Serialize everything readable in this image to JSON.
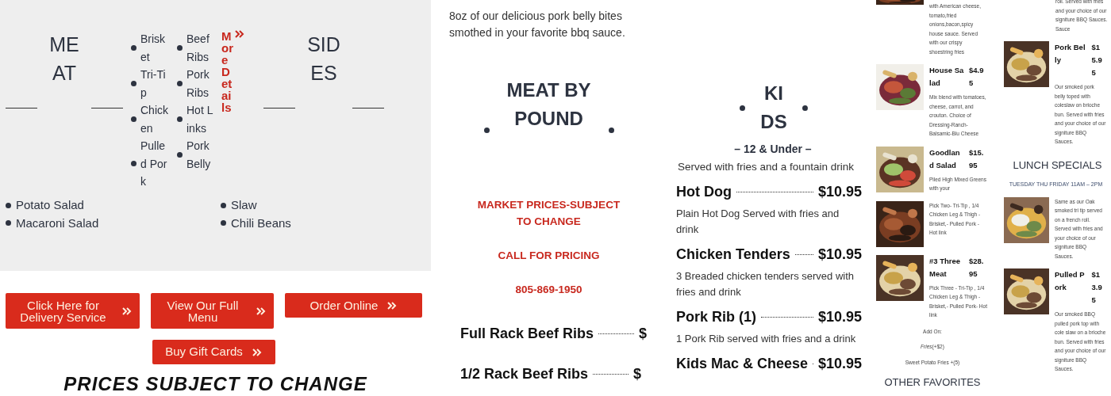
{
  "left": {
    "meat_heading": "MEAT",
    "meats_1": [
      "Brisket",
      "Tri-Tip",
      "Chicken",
      "Pulled Pork"
    ],
    "meats_2": [
      "Beef Ribs",
      "Pork Ribs",
      "Hot Links",
      "Pork Belly"
    ],
    "more_link": "More Details",
    "sides_heading": "SIDES",
    "sides_1": [
      "Potato Salad",
      "Macaroni Salad"
    ],
    "sides_2": [
      "Slaw",
      "Chili Beans"
    ],
    "buttons": [
      "Click Here for Delivery Service",
      "View Our Full Menu",
      "Order Online",
      "Buy Gift Cards"
    ],
    "banner": "PRICES SUBJECT TO CHANGE"
  },
  "pork_belly_bites": {
    "description": "8oz of our delicious pork belly bites smothed in your favorite bbq sauce."
  },
  "meat_by_pound": {
    "heading": "MEAT BY POUND",
    "notices": [
      "MARKET PRICES-SUBJECT TO CHANGE",
      "CALL FOR PRICING",
      "805-869-1950"
    ],
    "items": [
      {
        "name": "Full Rack Beef Ribs",
        "price": "$"
      },
      {
        "name": "1/2 Rack Beef Ribs",
        "price": "$"
      }
    ]
  },
  "kids": {
    "heading": "KIDS",
    "subheading": "– 12 & Under –",
    "note": "Served with fries and a fountain drink",
    "items": [
      {
        "name": "Hot Dog",
        "price": "$10.95",
        "description": "Plain Hot Dog Served with fries and drink"
      },
      {
        "name": "Chicken Tenders",
        "price": "$10.95",
        "description": "3 Breaded chicken tenders served with fries and drink"
      },
      {
        "name": "Pork Rib (1)",
        "price": "$10.95",
        "description": "1 Pork Rib served with fries and a drink"
      },
      {
        "name": "Kids Mac & Cheese",
        "price": "$10.95"
      }
    ]
  },
  "menu_column_1": {
    "top_description": "with American cheese, tomato,fried onions,bacon,spicy house sauce. Served with our crispy shoestring fries",
    "items": [
      {
        "name": "House Salad",
        "price": "$4.95",
        "description": "Mix blend with tomatoes, cheese, carrot, and crouton. Choice of Dressing-Ranch-Balsamic-Blu Cheese"
      },
      {
        "name": "Goodland Salad",
        "price": "$15.95",
        "description": "Piled High Mixed Greens with your"
      },
      {
        "description": "Pick Two- Tri-Tip , 1/4 Chicken Leg & Thigh - Brisket,- Pulled Pork - Hot link"
      },
      {
        "name": "#3 Three Meat",
        "price": "$28.95",
        "description": "Pick Three - Tri-Tip , 1/4 Chicken Leg & Thigh - Brisket,- Pulled Pork- Hot link"
      }
    ],
    "add_on_heading": "Add On:",
    "add_ons": [
      "*Fries*(+$2)",
      "Sweet Potato Fries +(5)"
    ],
    "section_heading": "OTHER FAVORITES"
  },
  "menu_column_2": {
    "top_description": "roll. Served with fries and your choice of our signiture BBQ Sauces. Sauce",
    "items": [
      {
        "name": "Pork Belly",
        "price": "$15.95",
        "description": "Our smoked pork belly toped with coleslaw on brioche bun. Served with fries and your choice of our signiture BBQ Sauces."
      }
    ],
    "section_heading": "LUNCH SPECIALS",
    "hours": "TUESDAY THU FRIDAY 11AM – 2PM",
    "lunch_items": [
      {
        "description": "Same as our Oak smoked tri tip served on a french roll. Served with fries and your choice of our signiture BBQ Sauces."
      },
      {
        "name": "Pulled Pork",
        "price": "$13.95",
        "description": "Our smoked BBQ pulled pork top with cole slaw on a brioche bun. Served with fries and your choice of our signiture BBQ Sauces."
      }
    ]
  }
}
